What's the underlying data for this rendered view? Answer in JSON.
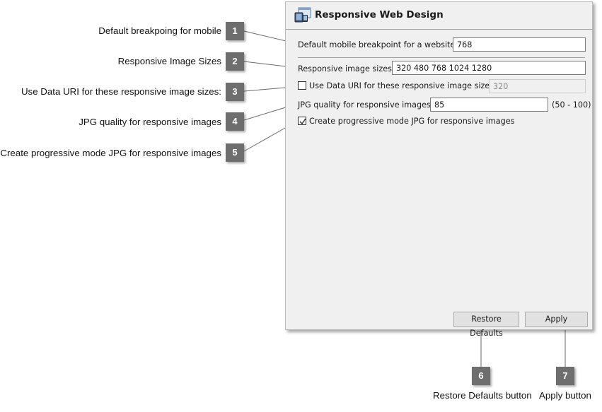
{
  "panel": {
    "title": "Responsive Web Design",
    "icon": "responsive-devices-icon",
    "fields": {
      "breakpoint": {
        "label": "Default mobile breakpoint for a website:",
        "value": "768"
      },
      "image_sizes": {
        "label": "Responsive image sizes:",
        "value": "320 480 768 1024 1280"
      },
      "data_uri": {
        "label": "Use Data URI for these responsive image sizes:",
        "checked": false,
        "value": "320",
        "enabled": false
      },
      "jpg_quality": {
        "label": "JPG quality for responsive images:",
        "value": "85",
        "range": "(50 - 100)"
      },
      "progressive": {
        "label": "Create progressive mode JPG for responsive images",
        "checked": true
      }
    },
    "buttons": {
      "restore": "Restore Defaults",
      "apply": "Apply"
    }
  },
  "callouts": [
    {
      "number": "1",
      "text": "Default breakpoing for mobile"
    },
    {
      "number": "2",
      "text": "Responsive Image Sizes"
    },
    {
      "number": "3",
      "text": "Use Data URI for these responsive image sizes:"
    },
    {
      "number": "4",
      "text": "JPG quality for responsive images"
    },
    {
      "number": "5",
      "text": "Create progressive mode JPG for responsive images"
    },
    {
      "number": "6",
      "text": "Restore Defaults button"
    },
    {
      "number": "7",
      "text": "Apply button"
    }
  ]
}
